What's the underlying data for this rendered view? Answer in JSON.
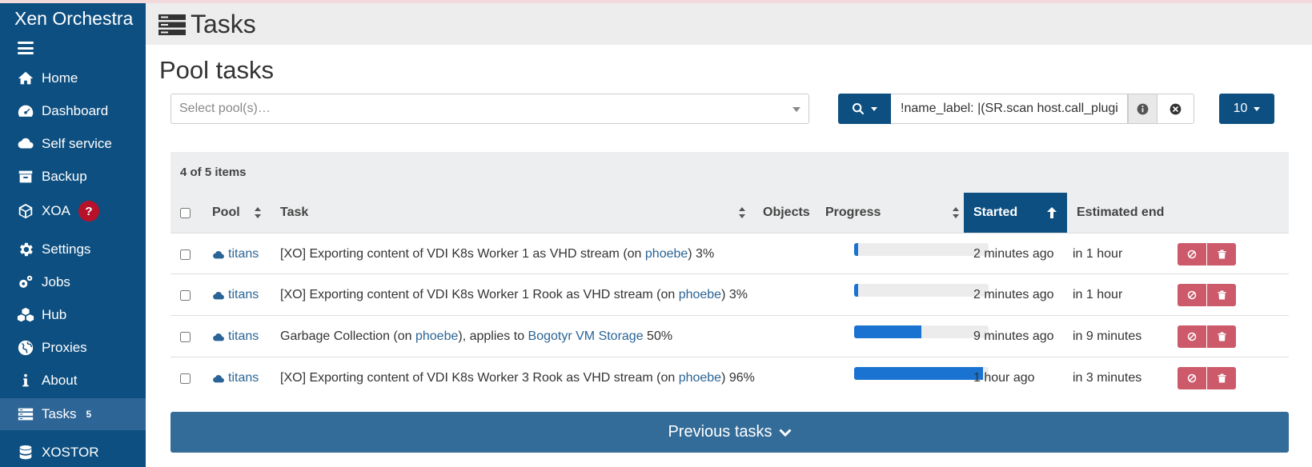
{
  "app": {
    "brand": "Xen Orchestra"
  },
  "sidebar": {
    "items": [
      {
        "label": "Home",
        "icon": "home-icon"
      },
      {
        "label": "Dashboard",
        "icon": "dashboard-icon"
      },
      {
        "label": "Self service",
        "icon": "cloud-icon"
      },
      {
        "label": "Backup",
        "icon": "archive-icon"
      },
      {
        "label": "XOA",
        "icon": "cube-icon",
        "badge": "?"
      },
      {
        "label": "Settings",
        "icon": "gear-icon"
      },
      {
        "label": "Jobs",
        "icon": "gears-icon"
      },
      {
        "label": "Hub",
        "icon": "cubes-icon"
      },
      {
        "label": "Proxies",
        "icon": "globe-icon"
      },
      {
        "label": "About",
        "icon": "info-icon"
      },
      {
        "label": "Tasks",
        "icon": "tasks-icon",
        "count": "5",
        "active": true
      },
      {
        "label": "XOSTOR",
        "icon": "database-icon"
      }
    ]
  },
  "header": {
    "title": "Tasks"
  },
  "main": {
    "section_title": "Pool tasks",
    "pool_select_placeholder": "Select pool(s)…",
    "search_value": "!name_label: |(SR.scan host.call_plugin",
    "page_size": "10",
    "item_count": "4 of 5 items",
    "columns": {
      "pool": "Pool",
      "task": "Task",
      "objects": "Objects",
      "progress": "Progress",
      "started": "Started",
      "estimated_end": "Estimated end"
    },
    "rows": [
      {
        "pool": "titans",
        "task_prefix": "[XO] Exporting content of VDI K8s Worker 1 as VHD stream (on ",
        "host": "phoebe",
        "task_suffix": ") 3%",
        "progress": 3,
        "started": "2 minutes ago",
        "estimated_end": "in 1 hour"
      },
      {
        "pool": "titans",
        "task_prefix": "[XO] Exporting content of VDI K8s Worker 1 Rook as VHD stream (on ",
        "host": "phoebe",
        "task_suffix": ") 3%",
        "progress": 3,
        "started": "2 minutes ago",
        "estimated_end": "in 1 hour"
      },
      {
        "pool": "titans",
        "task_prefix": "Garbage Collection (on ",
        "host": "phoebe",
        "task_middle": "), applies to ",
        "sr": "Bogotyr VM Storage",
        "task_suffix": " 50%",
        "progress": 50,
        "started": "9 minutes ago",
        "estimated_end": "in 9 minutes"
      },
      {
        "pool": "titans",
        "task_prefix": "[XO] Exporting content of VDI K8s Worker 3 Rook as VHD stream (on ",
        "host": "phoebe",
        "task_suffix": ") 96%",
        "progress": 96,
        "started": "1 hour ago",
        "estimated_end": "in 3 minutes"
      }
    ],
    "previous_tasks_label": "Previous tasks"
  },
  "colors": {
    "sidebar_bg": "#0d4f80",
    "sidebar_active": "#2d6596",
    "primary": "#0d4f80",
    "link": "#2a6496",
    "progress": "#1a73d1",
    "danger": "#cc5a6a",
    "badge": "#b8122a"
  }
}
